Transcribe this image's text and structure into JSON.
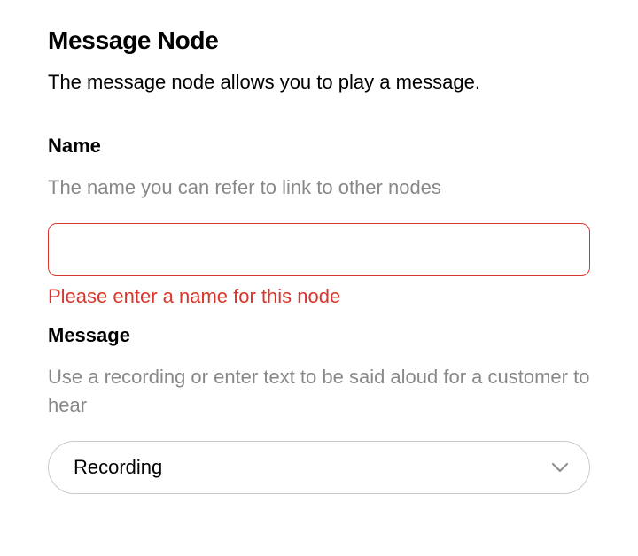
{
  "header": {
    "title": "Message Node",
    "description": "The message node allows you to play a message."
  },
  "fields": {
    "name": {
      "label": "Name",
      "hint": "The name you can refer to link to other nodes",
      "value": "",
      "error": "Please enter a name for this node"
    },
    "message": {
      "label": "Message",
      "hint": "Use a recording or enter text to be said aloud for a customer to hear",
      "selected": "Recording"
    }
  },
  "colors": {
    "error": "#d9352c",
    "hint": "#888888",
    "border": "#cbcbcb"
  }
}
